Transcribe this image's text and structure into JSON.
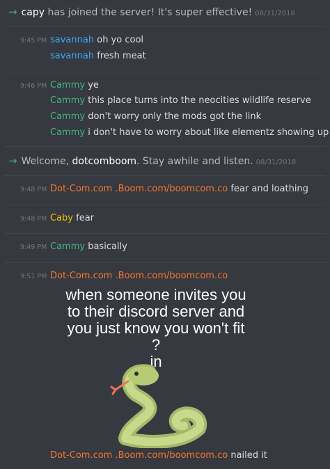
{
  "colors": {
    "background": "#36393f",
    "text": "#dcddde",
    "timestamp": "#72767d",
    "savannah": "#3fa9f5",
    "cammy": "#43b581",
    "dotcom": "#f57731",
    "caby": "#f1c40f",
    "join_arrow": "#43b581"
  },
  "system_messages": [
    {
      "icon": "arrow-right-icon",
      "user": "capy",
      "text": " has joined the server! It's super effective!",
      "date": "08/31/2018"
    },
    {
      "icon": "arrow-right-icon",
      "prefix": "Welcome, ",
      "user": "dotcomboom",
      "text": ". Stay awhile and listen.",
      "date": "08/31/2018"
    }
  ],
  "groups": [
    {
      "time": "9:45 PM",
      "author": "savannah",
      "lines": [
        "oh yo cool",
        "fresh meat"
      ]
    },
    {
      "time": "9:46 PM",
      "author": "Cammy",
      "lines": [
        "ye",
        "this place turns into the neocities wildlife reserve",
        "don't worry only the mods got the link",
        "i don't have to worry about like elementz showing up"
      ]
    },
    {
      "time": "9:48 PM",
      "author": "Dot-Com.com .Boom.com/boomcom.co",
      "lines": [
        "fear and loathing"
      ]
    },
    {
      "time": "9:48 PM",
      "author": "Caby",
      "lines": [
        "fear"
      ]
    },
    {
      "time": "9:49 PM",
      "author": "Cammy",
      "lines": [
        "basically"
      ]
    },
    {
      "time": "9:51 PM",
      "author": "Dot-Com.com .Boom.com/boomcom.co",
      "lines": [
        "nailed it"
      ]
    }
  ],
  "meme": {
    "lines": [
      "when someone invites you",
      "to their discord server and",
      "you just know you won't fit",
      "in"
    ],
    "question_mark": "?",
    "image": "snake-emoji"
  }
}
